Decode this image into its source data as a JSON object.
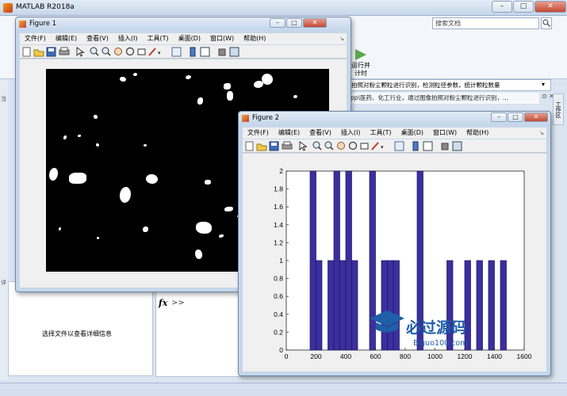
{
  "matlab": {
    "title": "MATLAB R2018a",
    "search_placeholder": "搜索文档",
    "run_label": "运行并计时",
    "address": "拍照对粉尘颗粒进行识别，检测粒径参数，统计颗粒数量",
    "description": "pp\\医药、化工行业，通过图像拍照对粉尘颗粒进行识别，...",
    "detail_text": "选择文件以查看详细信息",
    "cmd_fx": "fx",
    "cmd_prompt": ">>",
    "left_tab_labels": [
      "当",
      "详"
    ],
    "side_tab": "工作区"
  },
  "figure1": {
    "title": "Figure 1",
    "menus": [
      "文件(F)",
      "编辑(E)",
      "查看(V)",
      "插入(I)",
      "工具(T)",
      "桌面(D)",
      "窗口(W)",
      "帮助(H)"
    ]
  },
  "figure2": {
    "title": "Figure 2",
    "menus": [
      "文件(F)",
      "编辑(E)",
      "查看(V)",
      "插入(I)",
      "工具(T)",
      "桌面(D)",
      "窗口(W)",
      "帮助(H)"
    ]
  },
  "watermark": {
    "cn": "必过源码",
    "url": "Biguo100.com"
  },
  "colors": {
    "bar_fill": "#3b2f9e",
    "bar_edge": "#1a1460"
  },
  "chart_data": {
    "type": "bar",
    "title": "",
    "xlabel": "",
    "ylabel": "",
    "xlim": [
      0,
      1600
    ],
    "ylim": [
      0,
      2
    ],
    "xticks": [
      0,
      200,
      400,
      600,
      800,
      1000,
      1200,
      1400,
      1600
    ],
    "yticks": [
      0,
      0.2,
      0.4,
      0.6,
      0.8,
      1,
      1.2,
      1.4,
      1.6,
      1.8,
      2
    ],
    "bin_width": 40,
    "bins": [
      {
        "x0": 160,
        "value": 2
      },
      {
        "x0": 200,
        "value": 1
      },
      {
        "x0": 280,
        "value": 1
      },
      {
        "x0": 320,
        "value": 2
      },
      {
        "x0": 360,
        "value": 1
      },
      {
        "x0": 400,
        "value": 2
      },
      {
        "x0": 440,
        "value": 1
      },
      {
        "x0": 560,
        "value": 2
      },
      {
        "x0": 640,
        "value": 1
      },
      {
        "x0": 680,
        "value": 1
      },
      {
        "x0": 720,
        "value": 1
      },
      {
        "x0": 880,
        "value": 2
      },
      {
        "x0": 1080,
        "value": 1
      },
      {
        "x0": 1200,
        "value": 1
      },
      {
        "x0": 1280,
        "value": 1
      },
      {
        "x0": 1360,
        "value": 1
      },
      {
        "x0": 1440,
        "value": 1
      }
    ]
  }
}
